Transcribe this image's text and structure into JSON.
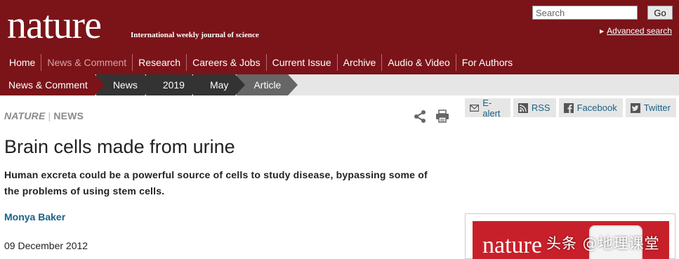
{
  "header": {
    "logo": "nature",
    "tagline": "International weekly journal of science",
    "search_placeholder": "Search",
    "go_label": "Go",
    "advanced_search": "Advanced search"
  },
  "nav": {
    "items": [
      {
        "label": "Home",
        "active": false
      },
      {
        "label": "News & Comment",
        "active": true
      },
      {
        "label": "Research",
        "active": false
      },
      {
        "label": "Careers & Jobs",
        "active": false
      },
      {
        "label": "Current Issue",
        "active": false
      },
      {
        "label": "Archive",
        "active": false
      },
      {
        "label": "Audio & Video",
        "active": false
      },
      {
        "label": "For Authors",
        "active": false
      }
    ]
  },
  "breadcrumb": [
    "News & Comment",
    "News",
    "2019",
    "May",
    "Article"
  ],
  "article": {
    "journal": "NATURE",
    "section": "NEWS",
    "title": "Brain cells made from urine",
    "standfirst": "Human excreta could be a powerful source of cells to study disease, bypassing some of the problems of using stem cells.",
    "author": "Monya Baker",
    "date": "09 December 2012"
  },
  "social": {
    "ealert": "E-alert",
    "rss": "RSS",
    "facebook": "Facebook",
    "twitter": "Twitter"
  },
  "promo": {
    "logo": "nature"
  },
  "watermark": "头条 @地理课堂",
  "colors": {
    "brand": "#7a1419",
    "link": "#1a6187",
    "crumb_dark": "#333333",
    "crumb_current": "#666666"
  }
}
